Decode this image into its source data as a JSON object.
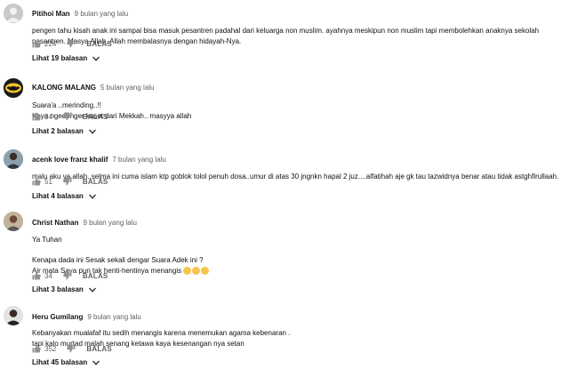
{
  "comments": [
    {
      "author": "Pitihoi Man",
      "time": "9 bulan yang lalu",
      "lines": [
        "pengen tahu kisah anak ini sampai bisa masuk pesantren padahal dari keluarga non muslim. ayahnya meskipun non muslim tapi membolehkan anaknya sekolah",
        "pesantren. Masya Allah, Allah membalasnya dengan hidayah-Nya."
      ],
      "likes": "224",
      "reply_label": "BALAS",
      "replies_label": "Lihat 19 balasan",
      "avatar_icon": "avatar-placeholder-icon"
    },
    {
      "author": "KALONG MALANG",
      "time": "5 bulan yang lalu",
      "lines": [
        "Suara'a ..merinding..!!",
        "Kaya ngedenger kaset dari Mekkah.. masyya allah"
      ],
      "likes": "34",
      "reply_label": "BALAS",
      "replies_label": "Lihat 2 balasan",
      "avatar_icon": "bat-logo-icon"
    },
    {
      "author": "acenk love franz khalif",
      "time": "7 bulan yang lalu",
      "lines": [
        "malu aku ya allah..selma ini cuma islam ktp goblok tolol penuh dosa..umur di atas 30 jngnkn hapal 2 juz....alfatihah aje gk tau tazwidnya benar atau tidak astghfirullaah."
      ],
      "likes": "51",
      "reply_label": "BALAS",
      "replies_label": "Lihat 4 balasan",
      "avatar_icon": "user-photo-icon"
    },
    {
      "author": "Christ Nathan",
      "time": "9 bulan yang lalu",
      "lines": [
        "Ya Tuhan",
        "",
        "Kenapa dada ini Sesak sekali dengar Suara Adek ini ?",
        "Air mata Saya pun tak henti-hentinya menangis"
      ],
      "emoji_count": 3,
      "likes": "34",
      "reply_label": "BALAS",
      "replies_label": "Lihat 3 balasan",
      "avatar_icon": "user-photo-icon"
    },
    {
      "author": "Heru Gumilang",
      "time": "9 bulan yang lalu",
      "lines": [
        "Kebanyakan mualafaf itu sedih menangis karena menemukan agama kebenaran .",
        "tapi kalo murtad malah senang ketawa kaya kesenangan nya setan"
      ],
      "likes": "352",
      "reply_label": "BALAS",
      "replies_label": "Lihat 45 balasan",
      "avatar_icon": "user-photo-icon"
    }
  ],
  "colors": {
    "text": "#111111",
    "meta": "#606060",
    "icon": "#909090",
    "emoji": "#f6c54a"
  }
}
